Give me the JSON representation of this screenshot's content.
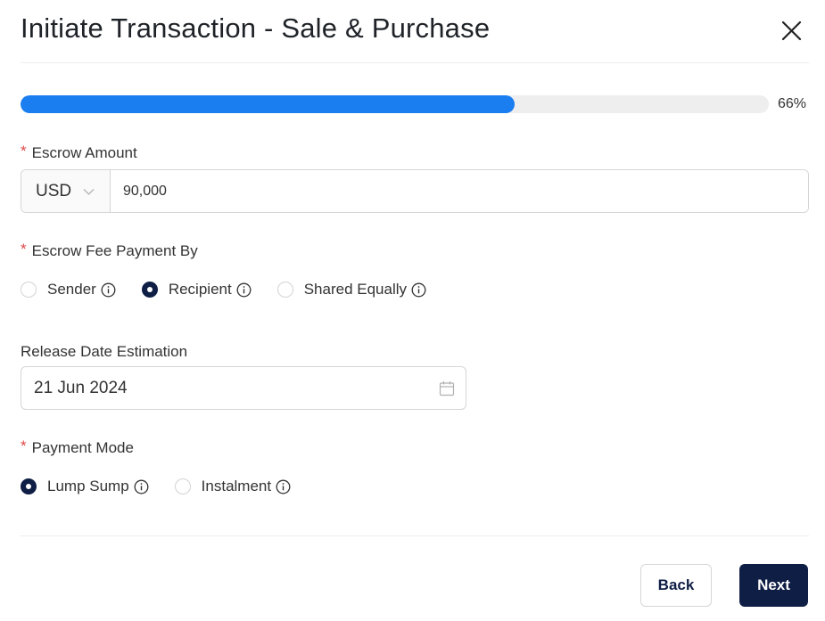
{
  "dialog": {
    "title": "Initiate Transaction - Sale & Purchase"
  },
  "progress": {
    "value": 0.66,
    "label": "66%"
  },
  "escrow_amount": {
    "required_mark": "*",
    "label": "Escrow Amount",
    "currency": "USD",
    "amount": "90,000"
  },
  "fee_payment": {
    "required_mark": "*",
    "label": "Escrow Fee Payment By",
    "options": [
      {
        "label": "Sender",
        "checked": false
      },
      {
        "label": "Recipient",
        "checked": true
      },
      {
        "label": "Shared Equally",
        "checked": false
      }
    ]
  },
  "release_date": {
    "label": "Release Date Estimation",
    "value": "21 Jun 2024"
  },
  "payment_mode": {
    "required_mark": "*",
    "label": "Payment Mode",
    "options": [
      {
        "label": "Lump Sump",
        "checked": true
      },
      {
        "label": "Instalment",
        "checked": false
      }
    ]
  },
  "footer": {
    "back_label": "Back",
    "next_label": "Next"
  },
  "icons": {
    "close": "close-icon",
    "chevron": "chevron-down-icon",
    "info": "info-icon",
    "calendar": "calendar-icon"
  },
  "colors": {
    "progress": "#1a7df0",
    "primary": "#0f1e45",
    "required": "#e04646"
  }
}
